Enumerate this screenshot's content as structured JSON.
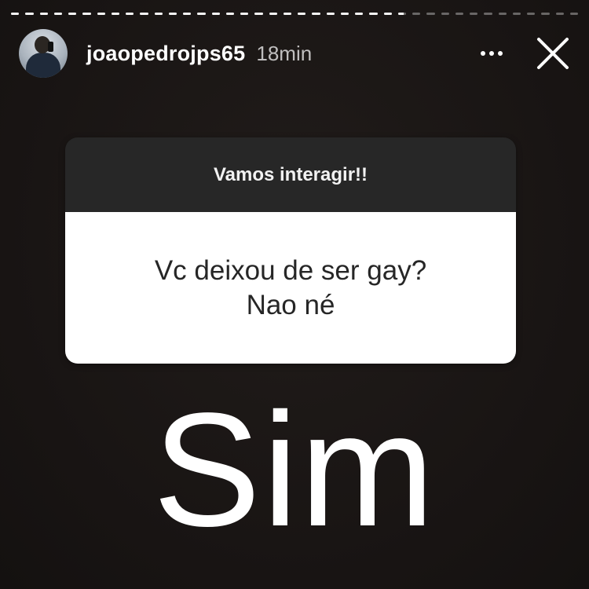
{
  "story": {
    "segments": [
      1,
      1,
      1,
      1,
      1,
      1,
      1,
      1,
      1,
      1,
      1,
      1,
      1,
      1,
      1,
      1,
      1,
      1,
      1,
      1,
      1,
      1,
      1,
      1,
      1,
      1,
      1,
      0.7,
      0,
      0,
      0,
      0,
      0,
      0,
      0,
      0,
      0,
      0,
      0,
      0
    ]
  },
  "header": {
    "username": "joaopedrojps65",
    "time": "18min",
    "avatar_icon": "profile-photo",
    "more_icon": "more-horizontal-icon",
    "close_icon": "close-icon"
  },
  "question_sticker": {
    "prompt": "Vamos interagir!!",
    "question_lines": [
      "Vc deixou de ser gay?",
      "Nao né"
    ]
  },
  "answer_text": "Sim"
}
